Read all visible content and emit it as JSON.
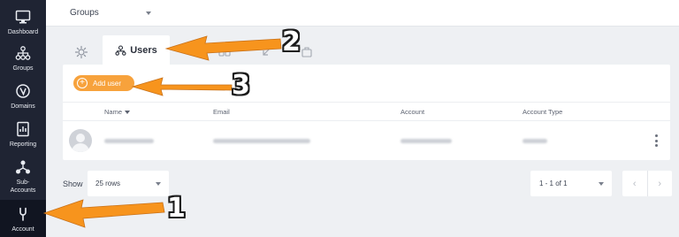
{
  "sidebar": {
    "items": [
      {
        "label": "Dashboard",
        "icon": "monitor-icon"
      },
      {
        "label": "Groups",
        "icon": "hierarchy-icon"
      },
      {
        "label": "Domains",
        "icon": "domains-icon"
      },
      {
        "label": "Reporting",
        "icon": "report-icon"
      },
      {
        "label": "Sub-\nAccounts",
        "icon": "sub-accounts-icon"
      },
      {
        "label": "Account",
        "icon": "wrench-icon"
      }
    ]
  },
  "topbar": {
    "title": "Groups"
  },
  "tabs": {
    "active_label": "Users"
  },
  "toolbar": {
    "add_user_label": "Add user"
  },
  "table": {
    "columns": [
      "Name",
      "Email",
      "Account",
      "Account Type"
    ],
    "rows": [
      {
        "name": "",
        "email": "",
        "account": "",
        "account_type": ""
      }
    ]
  },
  "footer": {
    "show_label": "Show",
    "rows_select": "25 rows",
    "page_range": "1 - 1 of 1",
    "prev": "‹",
    "next": "›"
  },
  "annotations": {
    "numbers": [
      "1",
      "2",
      "3"
    ],
    "arrow_color": "#f7941d"
  },
  "colors": {
    "sidebar_bg": "#1f2433",
    "accent": "#f7a23c",
    "panel_bg": "#ffffff",
    "page_bg": "#eef0f3"
  }
}
